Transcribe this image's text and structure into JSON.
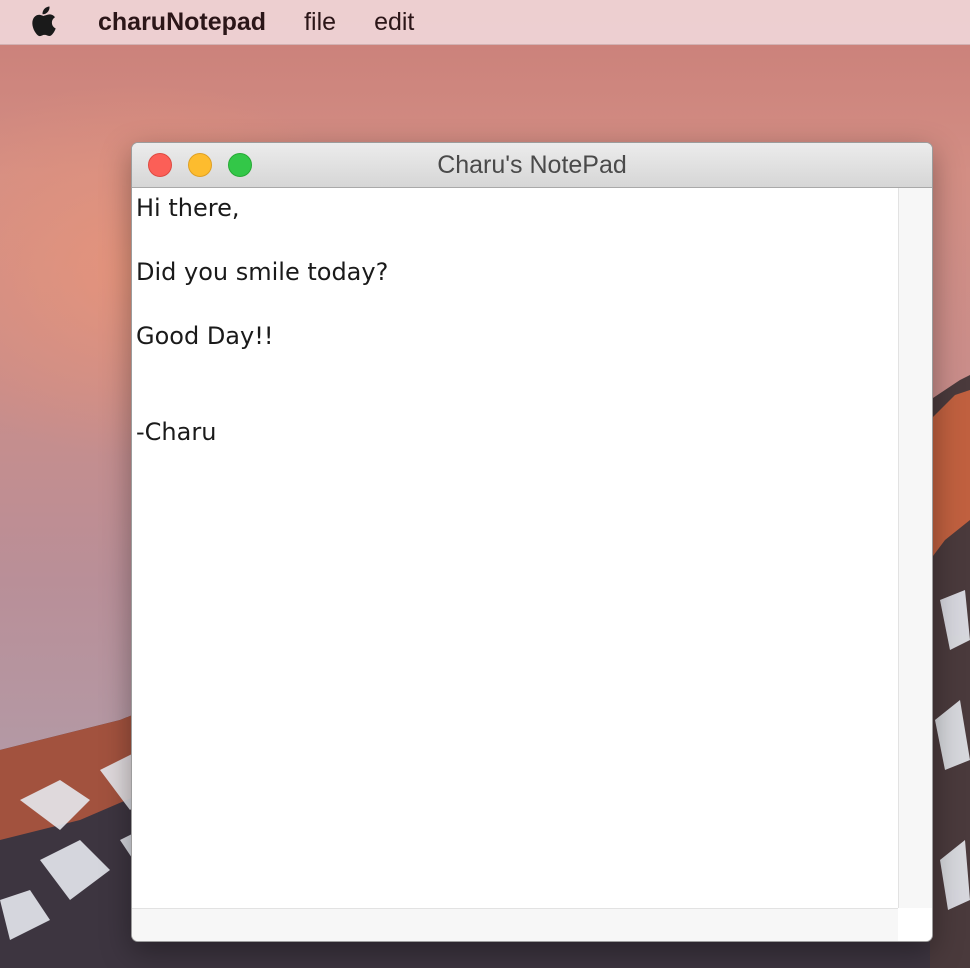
{
  "menubar": {
    "apple_icon": "apple-logo",
    "app_name": "charuNotepad",
    "items": [
      "file",
      "edit"
    ]
  },
  "window": {
    "title": "Charu's NotePad",
    "controls": [
      "close",
      "minimize",
      "zoom"
    ],
    "control_colors": {
      "close": "#fc5f57",
      "minimize": "#fdbc2e",
      "zoom": "#33c748"
    },
    "text_lines": [
      "Hi there,",
      "",
      "Did you smile today?",
      "",
      "Good Day!!",
      "",
      "",
      "-Charu"
    ]
  }
}
